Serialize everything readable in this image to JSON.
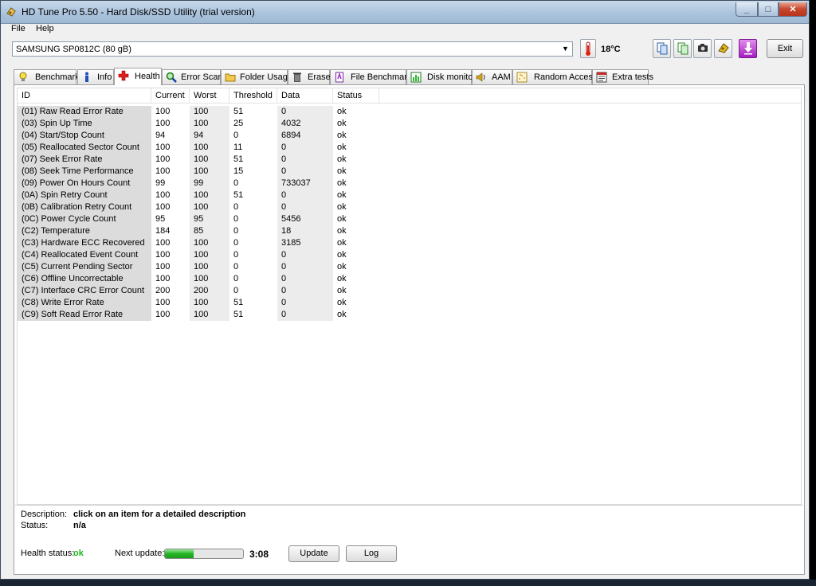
{
  "window": {
    "title": "HD Tune Pro 5.50 - Hard Disk/SSD Utility (trial version)",
    "minimize": "_",
    "maximize": "□",
    "close": "✕"
  },
  "menu": {
    "file": "File",
    "help": "Help"
  },
  "drive": {
    "selected": "SAMSUNG SP0812C (80 gB)",
    "temperature": "18°C"
  },
  "exit_label": "Exit",
  "tabs": [
    {
      "label": "Benchmark",
      "icon": "lightbulb-icon"
    },
    {
      "label": "Info",
      "icon": "info-icon"
    },
    {
      "label": "Health",
      "icon": "red-cross-icon"
    },
    {
      "label": "Error Scan",
      "icon": "magnifier-icon"
    },
    {
      "label": "Folder Usage",
      "icon": "folder-icon"
    },
    {
      "label": "Erase",
      "icon": "trash-icon"
    },
    {
      "label": "File Benchmark",
      "icon": "file-benchmark-icon"
    },
    {
      "label": "Disk monitor",
      "icon": "disk-monitor-icon"
    },
    {
      "label": "AAM",
      "icon": "speaker-icon"
    },
    {
      "label": "Random Access",
      "icon": "random-access-icon"
    },
    {
      "label": "Extra tests",
      "icon": "extra-tests-icon"
    }
  ],
  "health": {
    "columns": [
      "ID",
      "Current",
      "Worst",
      "Threshold",
      "Data",
      "Status"
    ],
    "rows": [
      [
        "(01) Raw Read Error Rate",
        "100",
        "100",
        "51",
        "0",
        "ok"
      ],
      [
        "(03) Spin Up Time",
        "100",
        "100",
        "25",
        "4032",
        "ok"
      ],
      [
        "(04) Start/Stop Count",
        "94",
        "94",
        "0",
        "6894",
        "ok"
      ],
      [
        "(05) Reallocated Sector Count",
        "100",
        "100",
        "11",
        "0",
        "ok"
      ],
      [
        "(07) Seek Error Rate",
        "100",
        "100",
        "51",
        "0",
        "ok"
      ],
      [
        "(08) Seek Time Performance",
        "100",
        "100",
        "15",
        "0",
        "ok"
      ],
      [
        "(09) Power On Hours Count",
        "99",
        "99",
        "0",
        "733037",
        "ok"
      ],
      [
        "(0A) Spin Retry Count",
        "100",
        "100",
        "51",
        "0",
        "ok"
      ],
      [
        "(0B) Calibration Retry Count",
        "100",
        "100",
        "0",
        "0",
        "ok"
      ],
      [
        "(0C) Power Cycle Count",
        "95",
        "95",
        "0",
        "5456",
        "ok"
      ],
      [
        "(C2) Temperature",
        "184",
        "85",
        "0",
        "18",
        "ok"
      ],
      [
        "(C3) Hardware ECC Recovered",
        "100",
        "100",
        "0",
        "3185",
        "ok"
      ],
      [
        "(C4) Reallocated Event Count",
        "100",
        "100",
        "0",
        "0",
        "ok"
      ],
      [
        "(C5) Current Pending Sector",
        "100",
        "100",
        "0",
        "0",
        "ok"
      ],
      [
        "(C6) Offline Uncorrectable",
        "100",
        "100",
        "0",
        "0",
        "ok"
      ],
      [
        "(C7) Interface CRC Error Count",
        "200",
        "200",
        "0",
        "0",
        "ok"
      ],
      [
        "(C8) Write Error Rate",
        "100",
        "100",
        "51",
        "0",
        "ok"
      ],
      [
        "(C9) Soft Read Error Rate",
        "100",
        "100",
        "51",
        "0",
        "ok"
      ]
    ]
  },
  "details": {
    "description_label": "Description:",
    "description_value": "click on an item for a detailed description",
    "status_label": "Status:",
    "status_value": "n/a"
  },
  "footer": {
    "health_status_label": "Health status:",
    "health_status_value": "ok",
    "next_update_label": "Next update:",
    "next_update_progress": 0.37,
    "next_update_time": "3:08",
    "update_button": "Update",
    "log_button": "Log"
  }
}
